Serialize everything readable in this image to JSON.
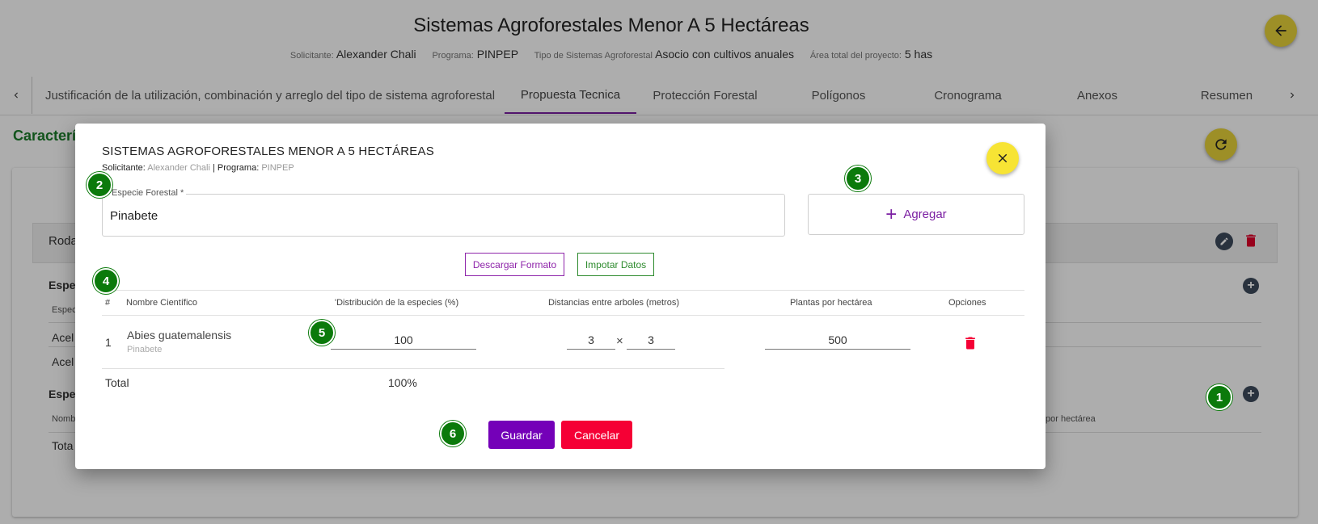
{
  "header": {
    "title": "Sistemas Agroforestales Menor A 5 Hectáreas",
    "meta": [
      {
        "key": "Solicitante:",
        "value": "Alexander Chali"
      },
      {
        "key": "Programa:",
        "value": "PINPEP"
      },
      {
        "key": "Tipo de Sistemas Agroforestal",
        "value": "Asocio con cultivos anuales"
      },
      {
        "key": "Área total del proyecto:",
        "value": "5 has"
      }
    ]
  },
  "tabs": [
    {
      "label": "Justificación de la utilización, combinación y arreglo del tipo de sistema agroforestal"
    },
    {
      "label": "Propuesta Tecnica"
    },
    {
      "label": "Protección Forestal"
    },
    {
      "label": "Polígonos"
    },
    {
      "label": "Cronograma"
    },
    {
      "label": "Anexos"
    },
    {
      "label": "Resumen"
    }
  ],
  "background": {
    "section_title": "Característ",
    "rodal_label": "Roda",
    "species_heading_1": "Espec",
    "col_small_1": "Espec",
    "row_1": "Acel",
    "row_2": "Acel",
    "species_heading_2": "Espe",
    "col_small_2": "Nomb",
    "col_small_right": "por hectárea",
    "total": "Tota"
  },
  "modal": {
    "title": "SISTEMAS AGROFORESTALES MENOR A 5 HECTÁREAS",
    "solicitante_key": "Solicitante:",
    "solicitante_value": "Alexander Chali",
    "separator": "|",
    "programa_key": "Programa:",
    "programa_value": "PINPEP",
    "field_label": "Especie Forestal *",
    "field_value": "Pinabete",
    "add_label": "Agregar",
    "download_label": "Descargar Formato",
    "import_label": "Impotar Datos",
    "columns": {
      "index": "#",
      "scientific": "Nombre Científico",
      "distribution": "'Distribución de la especies (%)",
      "distances": "Distancias entre arboles (metros)",
      "plants": "Plantas por hectárea",
      "options": "Opciones"
    },
    "rows": [
      {
        "index": "1",
        "scientific": "Abies guatemalensis",
        "common": "Pinabete",
        "distribution": "100",
        "dist_a": "3",
        "times": "×",
        "dist_b": "3",
        "plants": "500"
      }
    ],
    "total_label": "Total",
    "total_value": "100%",
    "save_label": "Guardar",
    "cancel_label": "Cancelar"
  },
  "steps": [
    "1",
    "2",
    "3",
    "4",
    "5",
    "6"
  ],
  "colors": {
    "accent_purple": "#7400b8",
    "danger_red": "#f50035",
    "fab_yellow": "#f7e434",
    "section_green": "#1b7d2a",
    "step_green": "#0b7a0b"
  }
}
